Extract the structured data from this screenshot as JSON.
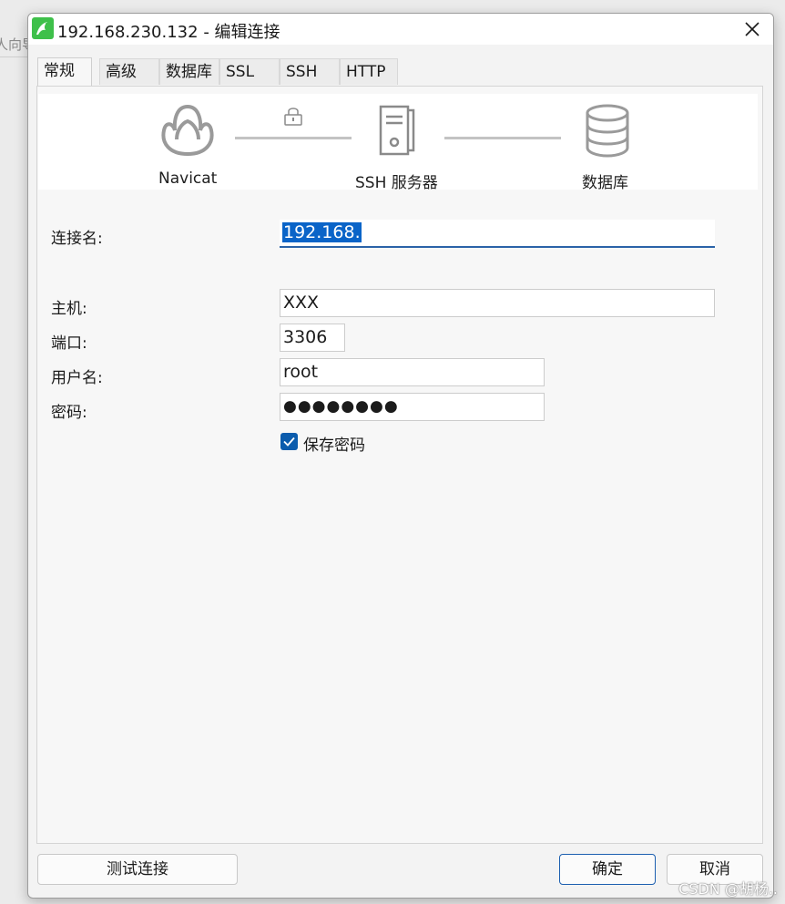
{
  "background": {
    "fragment_text": "人向导"
  },
  "window": {
    "title": "192.168.230.132 - 编辑连接",
    "icons": {
      "app": "navicat-mysql-icon",
      "close": "close-icon"
    }
  },
  "tabs": [
    {
      "label": "常规",
      "active": true
    },
    {
      "label": "高级",
      "active": false
    },
    {
      "label": "数据库",
      "active": false
    },
    {
      "label": "SSL",
      "active": false
    },
    {
      "label": "SSH",
      "active": false
    },
    {
      "label": "HTTP",
      "active": false
    }
  ],
  "diagram": {
    "navicat_label": "Navicat",
    "ssh_label": "SSH 服务器",
    "db_label": "数据库",
    "icons": [
      "navicat-logo-icon",
      "lock-icon",
      "server-icon",
      "database-icon"
    ]
  },
  "form": {
    "connection_name": {
      "label": "连接名:",
      "value": "192.168."
    },
    "host": {
      "label": "主机:",
      "value": "XXX"
    },
    "port": {
      "label": "端口:",
      "value": "3306"
    },
    "username": {
      "label": "用户名:",
      "value": "root"
    },
    "password": {
      "label": "密码:",
      "value": "●●●●●●●●"
    },
    "save_password": {
      "label": "保存密码",
      "checked": true
    }
  },
  "buttons": {
    "test": "测试连接",
    "ok": "确定",
    "cancel": "取消"
  },
  "watermark": "CSDN @胡杨..",
  "colors": {
    "accent": "#0b5cad",
    "selection": "#0a64c8",
    "app_icon": "#3ec04a"
  }
}
